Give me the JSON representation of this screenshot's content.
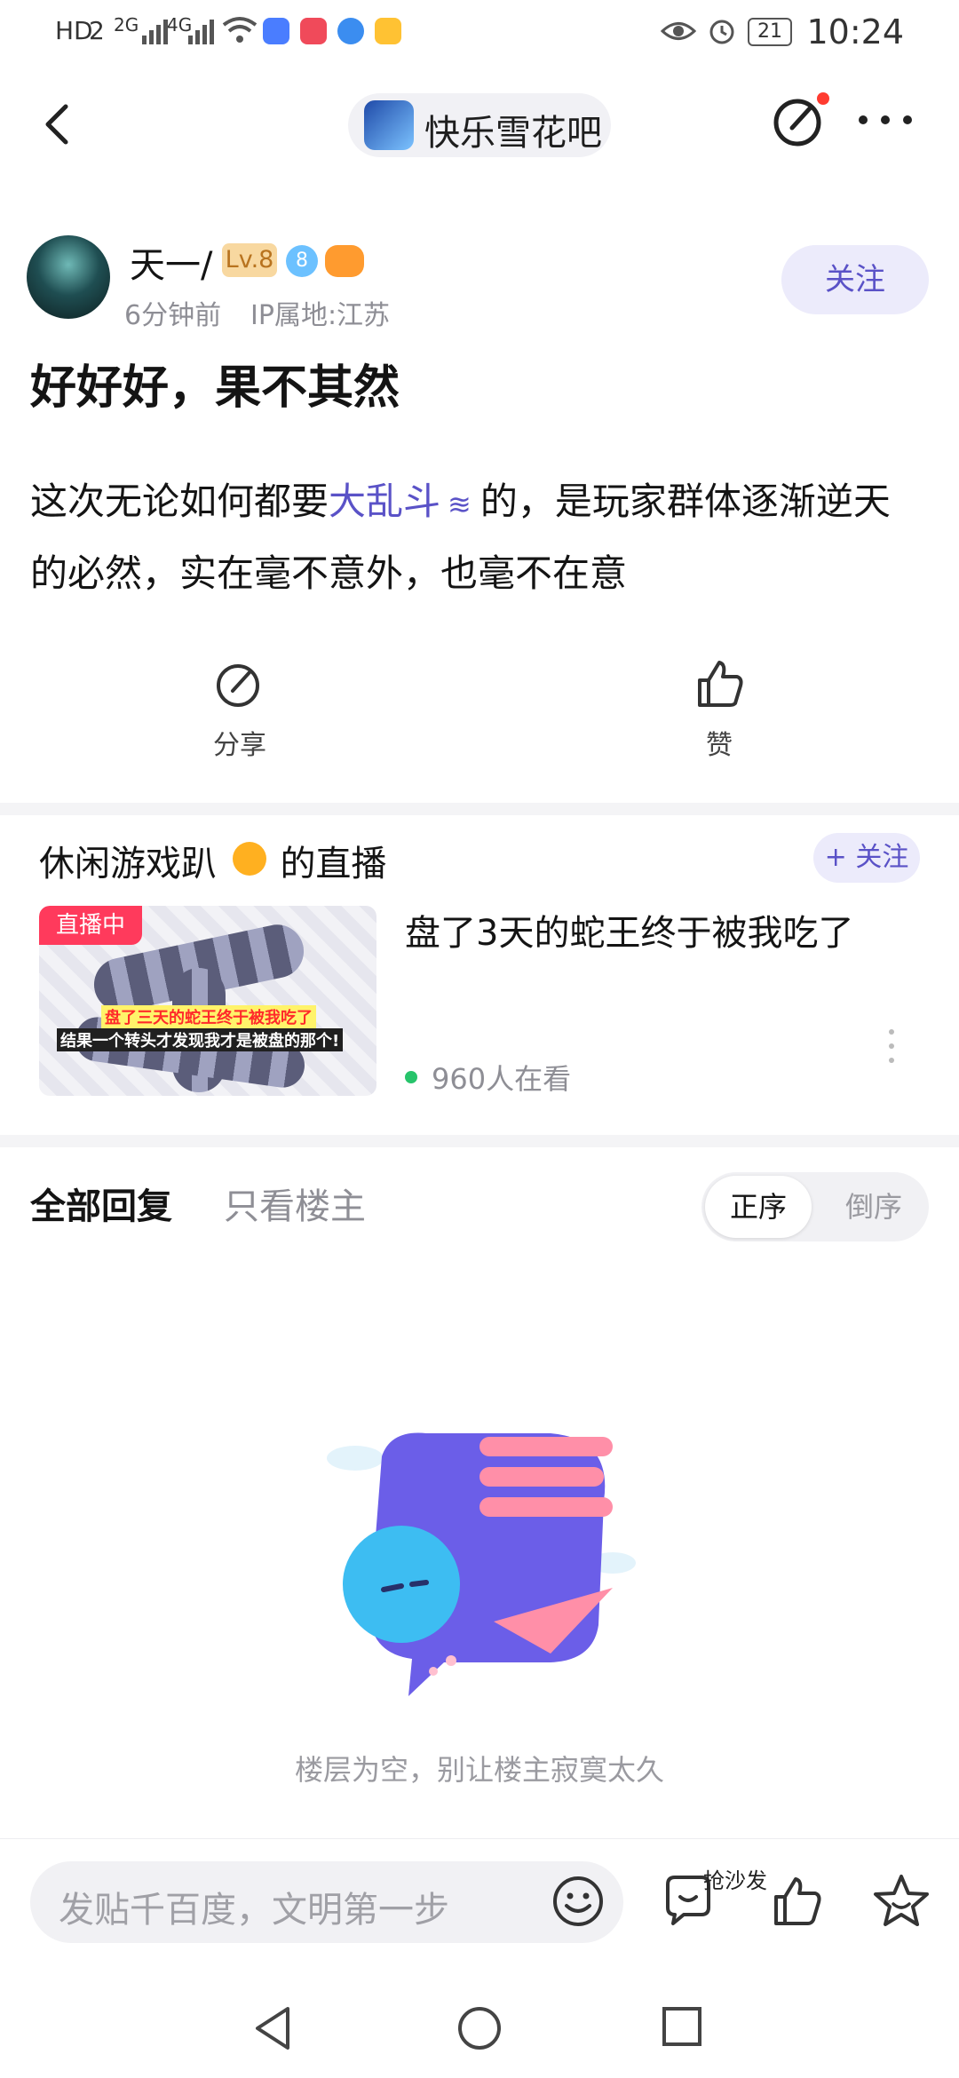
{
  "status_bar": {
    "left_icons": [
      "HD",
      "2",
      "2G",
      "4G"
    ],
    "battery": "21",
    "time": "10:24"
  },
  "header": {
    "forum_name": "快乐雪花吧"
  },
  "post": {
    "author": "天一/",
    "level_badge": "Lv.8",
    "gem_level": "8",
    "time_ago": "6分钟前",
    "ip_location": "IP属地:江苏",
    "follow_label": "关注",
    "title": "好好好，果不其然",
    "body_before": "这次无论如何都要",
    "body_link": "大乱斗",
    "body_after": "的，是玩家群体逐渐逆天的必然，实在毫不意外，也毫不在意",
    "share_label": "分享",
    "like_label": "赞"
  },
  "live": {
    "streamer_prefix": "休闲游戏趴",
    "streamer_suffix": "的直播",
    "follow_label": "+ 关注",
    "tag": "直播中",
    "title": "盘了3天的蛇王终于被我吃了",
    "viewers": "960人在看",
    "thumb_caption_1": "盘了三天的蛇王终于被我吃了",
    "thumb_caption_2": "结果一个转头才发现我才是被盘的那个!"
  },
  "replies": {
    "tab_all": "全部回复",
    "tab_owner": "只看楼主",
    "sort_asc": "正序",
    "sort_desc": "倒序",
    "empty_text": "楼层为空，别让楼主寂寞太久"
  },
  "bottom": {
    "input_placeholder": "发贴千百度，文明第一步",
    "sofa_label": "抢沙发"
  },
  "colors": {
    "accent": "#5a52c7",
    "accent_bg": "#ecebfb",
    "live_red": "#ff3a5c",
    "online_green": "#27c46b"
  }
}
